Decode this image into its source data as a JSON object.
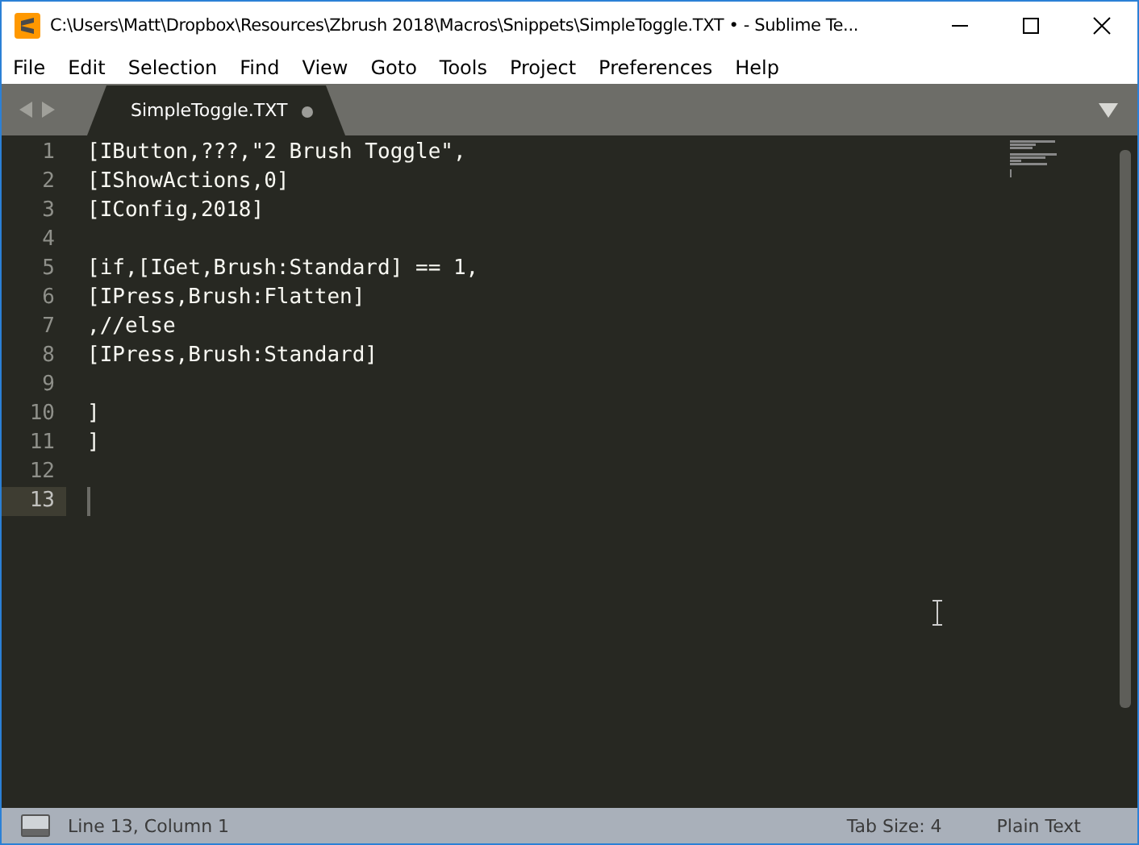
{
  "window": {
    "title": "C:\\Users\\Matt\\Dropbox\\Resources\\Zbrush 2018\\Macros\\Snippets\\SimpleToggle.TXT • - Sublime Te..."
  },
  "menu": [
    "File",
    "Edit",
    "Selection",
    "Find",
    "View",
    "Goto",
    "Tools",
    "Project",
    "Preferences",
    "Help"
  ],
  "tabs": [
    {
      "label": "SimpleToggle.TXT",
      "selected": true,
      "modified": true
    }
  ],
  "editor": {
    "lines": [
      {
        "number": "1",
        "text": "[IButton,???,\"2 Brush Toggle\",",
        "current": false
      },
      {
        "number": "2",
        "text": "[IShowActions,0]",
        "current": false
      },
      {
        "number": "3",
        "text": "[IConfig,2018]",
        "current": false
      },
      {
        "number": "4",
        "current": false
      },
      {
        "number": "5",
        "text": "[if,[IGet,Brush:Standard] == 1,",
        "current": false
      },
      {
        "number": "6",
        "text": "[IPress,Brush:Flatten]",
        "current": false
      },
      {
        "number": "7",
        "text": ",//else",
        "current": false
      },
      {
        "number": "8",
        "text": "[IPress,Brush:Standard]",
        "current": false
      },
      {
        "number": "9",
        "current": false
      },
      {
        "number": "10",
        "text": "]",
        "current": false
      },
      {
        "number": "11",
        "text": "]",
        "current": false
      },
      {
        "number": "12",
        "current": false
      },
      {
        "number": "13",
        "current": true
      }
    ]
  },
  "status_bar": {
    "position": "Line 13, Column 1",
    "tab_size": "Tab Size: 4",
    "syntax": "Plain Text"
  }
}
